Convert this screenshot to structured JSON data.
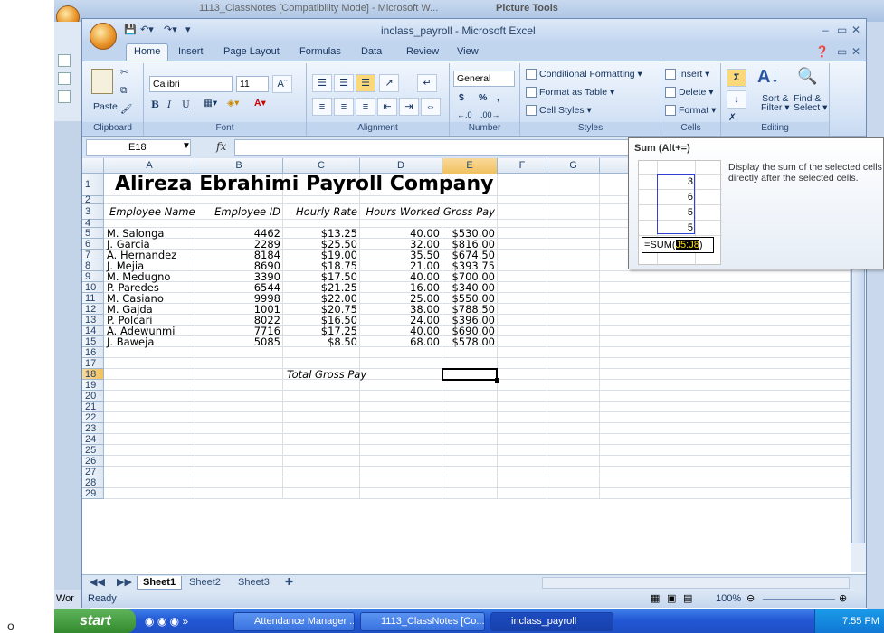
{
  "background": {
    "word_title": "1113_ClassNotes [Compatibility Mode] - Microsoft W...",
    "picture_tools": "Picture Tools",
    "status_word": "Wor"
  },
  "window": {
    "title": "inclass_payroll - Microsoft Excel"
  },
  "ribbon": {
    "tabs": [
      "Home",
      "Insert",
      "Page Layout",
      "Formulas",
      "Data",
      "Review",
      "View"
    ],
    "clipboard": {
      "label": "Clipboard",
      "paste": "Paste"
    },
    "font": {
      "label": "Font",
      "name": "Calibri",
      "size": "11",
      "bold": "B",
      "italic": "I",
      "underline": "U"
    },
    "alignment": {
      "label": "Alignment"
    },
    "number": {
      "label": "Number",
      "format": "General",
      "currency": "$",
      "percent": "%",
      "comma": ","
    },
    "styles": {
      "label": "Styles",
      "conditional": "Conditional Formatting",
      "format_table": "Format as Table",
      "cell_styles": "Cell Styles"
    },
    "cells": {
      "label": "Cells",
      "insert": "Insert",
      "delete": "Delete",
      "format": "Format"
    },
    "editing": {
      "label": "Editing",
      "sort": "Sort &",
      "filter": "Filter",
      "find": "Find &",
      "select": "Select"
    }
  },
  "formula_bar": {
    "name_box": "E18",
    "fx": "fx",
    "formula": ""
  },
  "columns": [
    "A",
    "B",
    "C",
    "D",
    "E",
    "F",
    "G",
    "H"
  ],
  "rows": [
    "1",
    "2",
    "3",
    "4",
    "5",
    "6",
    "7",
    "8",
    "9",
    "10",
    "11",
    "12",
    "13",
    "14",
    "15",
    "16",
    "17",
    "18",
    "19",
    "20",
    "21",
    "22",
    "23",
    "24",
    "25",
    "26",
    "27",
    "28",
    "29"
  ],
  "sheet": {
    "title": "Alireza Ebrahimi Payroll Company",
    "headers": [
      "Employee Name",
      "Employee ID",
      "Hourly Rate",
      "Hours Worked",
      "Gross Pay"
    ],
    "data_rows": [
      [
        "M. Salonga",
        "4462",
        "$13.25",
        "40.00",
        "$530.00"
      ],
      [
        "J. Garcia",
        "2289",
        "$25.50",
        "32.00",
        "$816.00"
      ],
      [
        "A. Hernandez",
        "8184",
        "$19.00",
        "35.50",
        "$674.50"
      ],
      [
        "J. Mejia",
        "8690",
        "$18.75",
        "21.00",
        "$393.75"
      ],
      [
        "M. Medugno",
        "3390",
        "$17.50",
        "40.00",
        "$700.00"
      ],
      [
        "P. Paredes",
        "6544",
        "$21.25",
        "16.00",
        "$340.00"
      ],
      [
        "M. Casiano",
        "9998",
        "$22.00",
        "25.00",
        "$550.00"
      ],
      [
        "M. Gajda",
        "1001",
        "$20.75",
        "38.00",
        "$788.50"
      ],
      [
        "P. Polcari",
        "8022",
        "$16.50",
        "24.00",
        "$396.00"
      ],
      [
        "A. Adewunmi",
        "7716",
        "$17.25",
        "40.00",
        "$690.00"
      ],
      [
        "J. Baweja",
        "5085",
        "$8.50",
        "68.00",
        "$578.00"
      ]
    ],
    "total_label": "Total Gross Pay"
  },
  "sheet_tabs": [
    "Sheet1",
    "Sheet2",
    "Sheet3"
  ],
  "status": {
    "ready": "Ready",
    "zoom": "100%"
  },
  "tooltip": {
    "title": "Sum (Alt+=)",
    "description": "Display the sum of the selected cells directly after the selected cells.",
    "preview_values": [
      "3",
      "6",
      "5",
      "5"
    ],
    "formula_prefix": "=SUM(",
    "formula_range": "J5:J8",
    "formula_suffix": ")"
  },
  "taskbar": {
    "start": "start",
    "buttons": [
      "Attendance Manager ...",
      "1113_ClassNotes [Co...",
      "inclass_payroll"
    ],
    "clock": "7:55 PM"
  },
  "colors": {
    "accent": "#1e4fc6",
    "selected_header": "#f1c15f",
    "title_bar": "#c2d5ef"
  }
}
